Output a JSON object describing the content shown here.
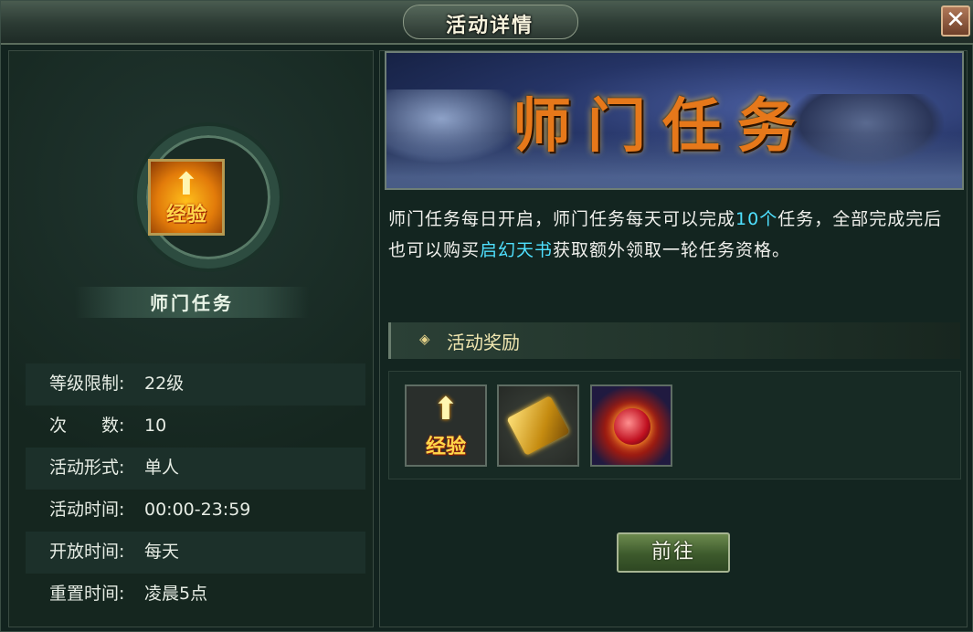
{
  "window": {
    "title": "活动详情",
    "close_label": "✕"
  },
  "activity": {
    "icon_label": "经验",
    "name": "师门任务",
    "rows": [
      {
        "key": "等级限制:",
        "value": "22级"
      },
      {
        "key": "次　　数:",
        "value": "10"
      },
      {
        "key": "活动形式:",
        "value": "单人"
      },
      {
        "key": "活动时间:",
        "value": "00:00-23:59"
      },
      {
        "key": "开放时间:",
        "value": "每天"
      },
      {
        "key": "重置时间:",
        "value": "凌晨5点"
      }
    ]
  },
  "banner": {
    "title": "师门任务"
  },
  "description": {
    "part1": "师门任务每日开启，师门任务每天可以完成",
    "highlight1": "10个",
    "part2": "任务，全部完成完后也可以购买",
    "highlight2": "启幻天书",
    "part3": "获取额外领取一轮任务资格。"
  },
  "rewards": {
    "title": "活动奖励",
    "items": [
      {
        "name": "exp-item",
        "label": "经验"
      },
      {
        "name": "scroll-item"
      },
      {
        "name": "orb-item"
      }
    ]
  },
  "go_button": {
    "label": "前往"
  },
  "colors": {
    "highlight": "#4fe0ff",
    "button": "#4d6b38",
    "panel": "#132520"
  }
}
